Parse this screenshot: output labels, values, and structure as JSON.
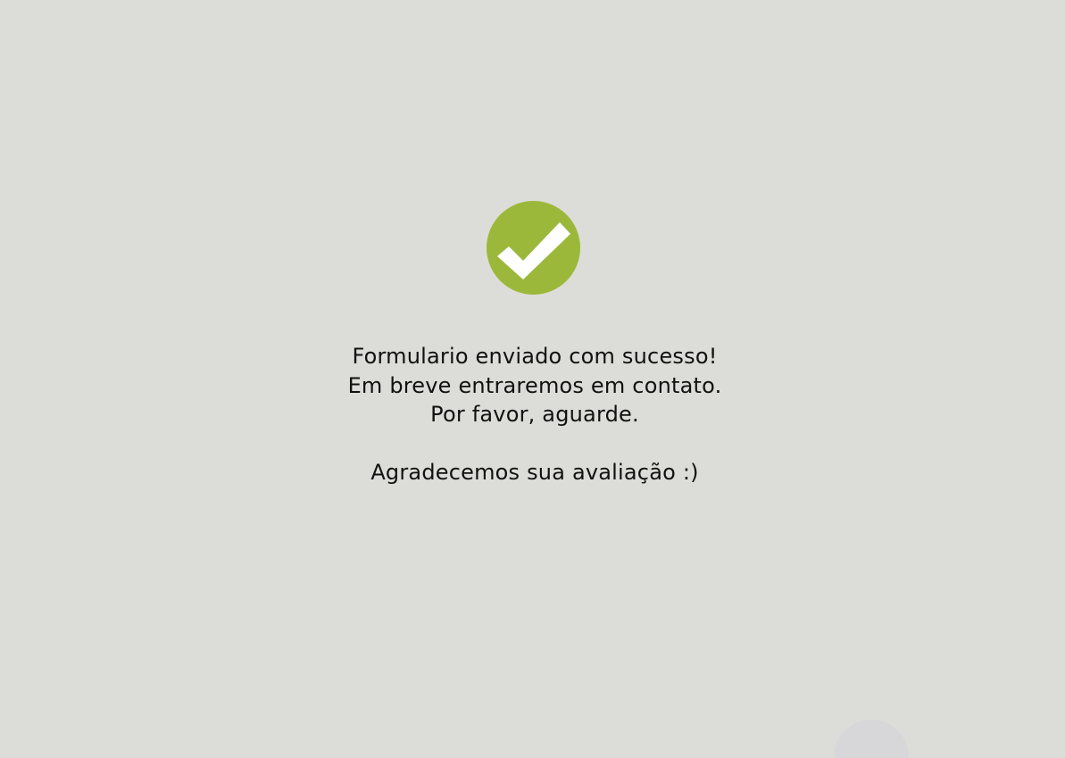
{
  "success": {
    "icon": "check-circle-icon",
    "accent_color": "#9cb83b",
    "line1": "Formulario enviado com sucesso!",
    "line2": "Em breve entraremos em contato.",
    "line3": "Por favor, aguarde.",
    "thanks": "Agradecemos sua avaliação :)"
  },
  "colors": {
    "background": "#dcddd8",
    "text": "#111111"
  }
}
